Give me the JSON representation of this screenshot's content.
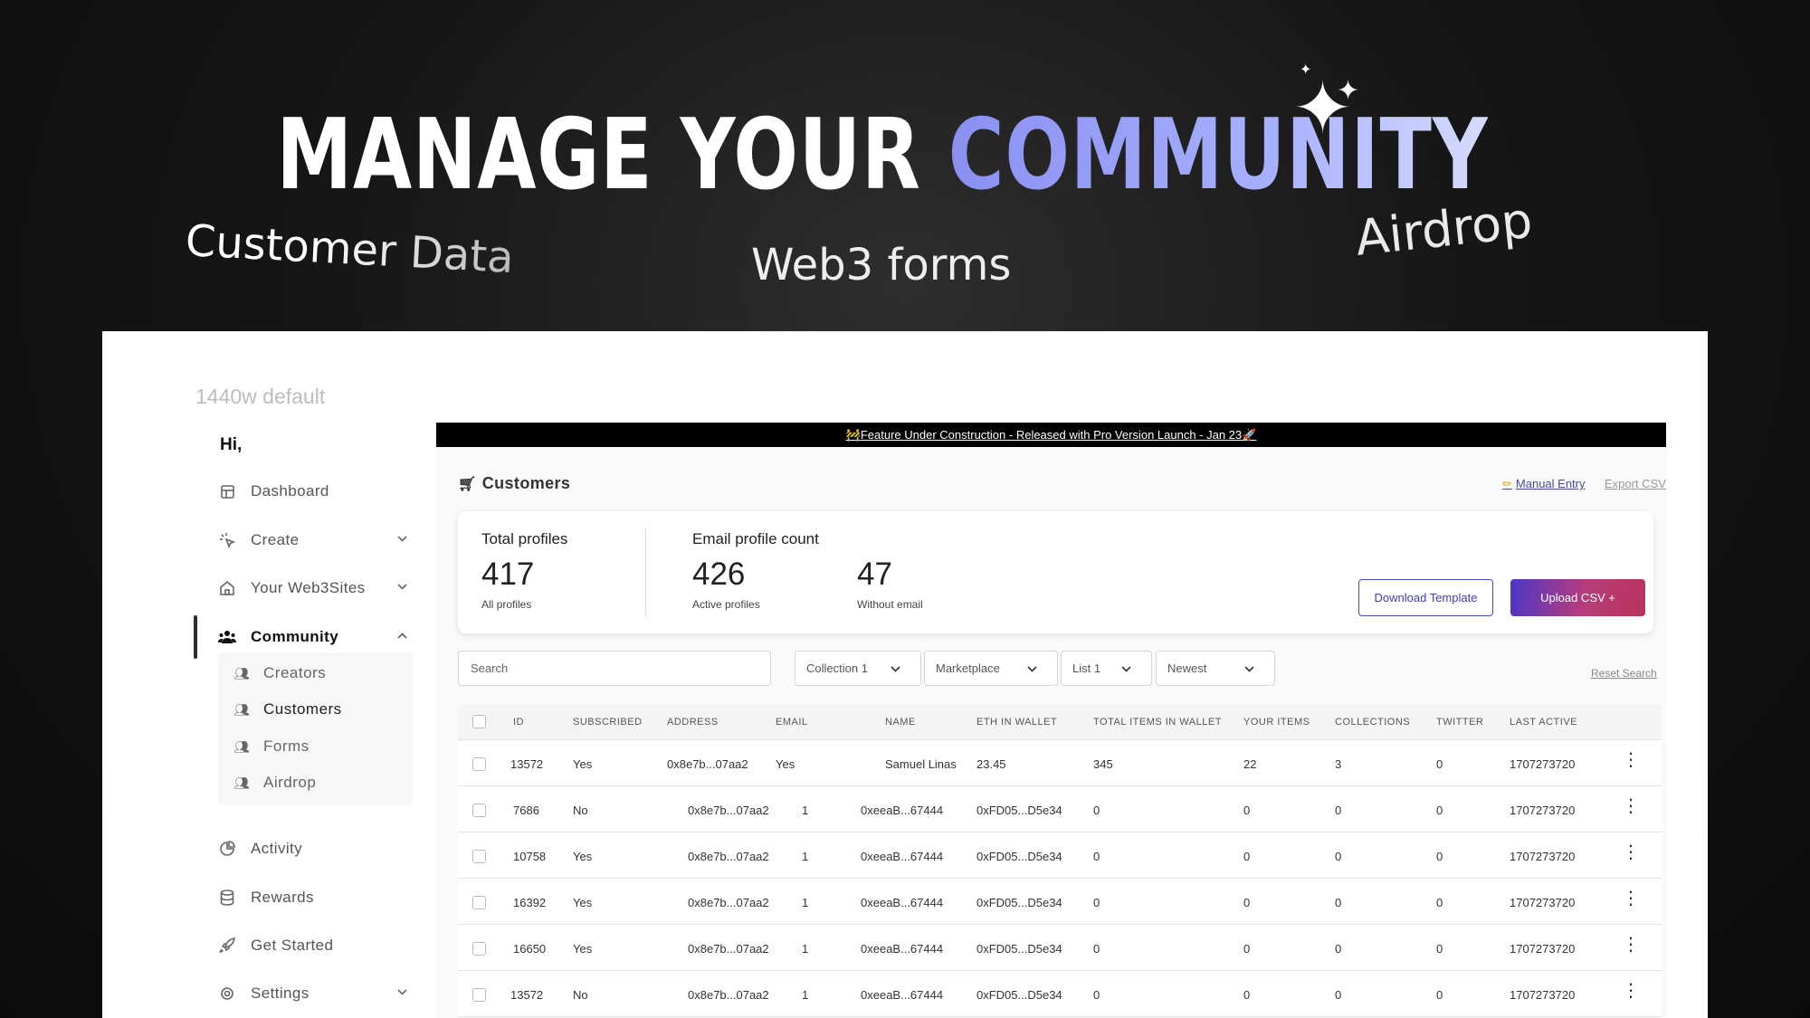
{
  "hero": {
    "title_main": "MANAGE YOUR ",
    "title_accent": "COMMUNITY",
    "floating": {
      "customer_data": "Customer Data",
      "web3_forms": "Web3 forms",
      "airdrop": "Airdrop"
    }
  },
  "frame_label": "1440w default",
  "sidebar": {
    "greeting": "Hi,",
    "items": [
      {
        "label": "Dashboard",
        "icon": "dashboard-icon"
      },
      {
        "label": "Create",
        "icon": "cursor-click-icon"
      },
      {
        "label": "Your Web3Sites",
        "icon": "home-icon"
      },
      {
        "label": "Community",
        "icon": "users-icon"
      },
      {
        "label": "Activity",
        "icon": "pie-chart-icon"
      },
      {
        "label": "Rewards",
        "icon": "database-icon"
      },
      {
        "label": "Get Started",
        "icon": "rocket-icon"
      },
      {
        "label": "Settings",
        "icon": "gear-icon"
      }
    ],
    "subitems": [
      {
        "label": "Creators"
      },
      {
        "label": "Customers"
      },
      {
        "label": "Forms"
      },
      {
        "label": "Airdrop"
      }
    ]
  },
  "banner": "🚧Feature Under Construction - Released with Pro Version Launch - Jan 23🚀",
  "page": {
    "title": "Customers",
    "manual_entry": "Manual Entry",
    "export_csv": "Export CSV"
  },
  "stats": {
    "total_profiles_label": "Total profiles",
    "total_profiles_value": "417",
    "total_profiles_sub": "All profiles",
    "email_count_label": "Email profile count",
    "active_value": "426",
    "active_sub": "Active profiles",
    "without_email_value": "47",
    "without_email_sub": "Without email",
    "download_template": "Download Template",
    "upload_csv": "Upload CSV +"
  },
  "filters": {
    "search_placeholder": "Search",
    "collection": "Collection 1",
    "marketplace": "Marketplace",
    "list": "List 1",
    "sort": "Newest",
    "reset": "Reset Search"
  },
  "table": {
    "columns": [
      "ID",
      "SUBSCRIBED",
      "ADDRESS",
      "EMAIL",
      "NAME",
      "ETH IN WALLET",
      "TOTAL ITEMS IN WALLET",
      "YOUR ITEMS",
      "COLLECTIONS",
      "TWITTER",
      "LAST ACTIVE"
    ],
    "rows": [
      [
        "13572",
        "Yes",
        "0x8e7b...07aa2",
        "Yes",
        "Samuel Linas",
        "23.45",
        "345",
        "22",
        "3",
        "0",
        "1707273720"
      ],
      [
        "7686",
        "No",
        "0x8e7b...07aa2",
        "1",
        "0xeeaB...67444",
        "0xFD05...D5e34",
        "0",
        "0",
        "0",
        "0",
        "1707273720"
      ],
      [
        "10758",
        "Yes",
        "0x8e7b...07aa2",
        "1",
        "0xeeaB...67444",
        "0xFD05...D5e34",
        "0",
        "0",
        "0",
        "0",
        "1707273720"
      ],
      [
        "16392",
        "Yes",
        "0x8e7b...07aa2",
        "1",
        "0xeeaB...67444",
        "0xFD05...D5e34",
        "0",
        "0",
        "0",
        "0",
        "1707273720"
      ],
      [
        "16650",
        "Yes",
        "0x8e7b...07aa2",
        "1",
        "0xeeaB...67444",
        "0xFD05...D5e34",
        "0",
        "0",
        "0",
        "0",
        "1707273720"
      ],
      [
        "13572",
        "No",
        "0x8e7b...07aa2",
        "1",
        "0xeeaB...67444",
        "0xFD05...D5e34",
        "0",
        "0",
        "0",
        "0",
        "1707273720"
      ]
    ]
  }
}
